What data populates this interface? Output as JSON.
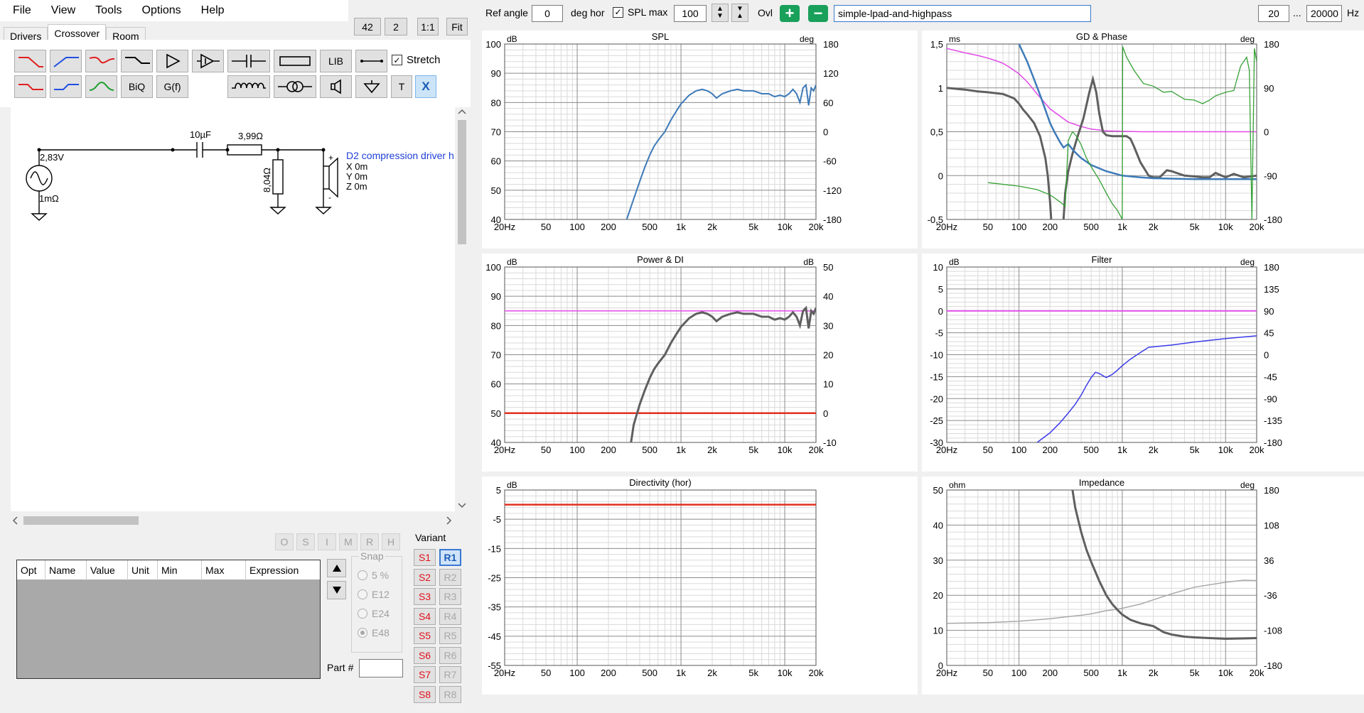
{
  "menu": [
    "File",
    "View",
    "Tools",
    "Options",
    "Help"
  ],
  "tabs": [
    "Drivers",
    "Crossover",
    "Room"
  ],
  "zoom_buttons": [
    "42",
    "2",
    "1:1",
    "Fit"
  ],
  "toolbar": {
    "lib_label": "LIB",
    "biq_label": "BiQ",
    "gf_label": "G(f)",
    "t_label": "T",
    "x_label": "X",
    "stretch_label": "Stretch",
    "stretch_checked": true
  },
  "schematic": {
    "source_voltage": "2,83V",
    "source_impedance": "1mΩ",
    "capacitor": "10µF",
    "series_resistor": "3,99Ω",
    "shunt_resistor": "8,04Ω",
    "driver_name": "D2 compression driver h",
    "driver_x": "X 0m",
    "driver_y": "Y 0m",
    "driver_z": "Z 0m",
    "plus": "+",
    "minus": "-"
  },
  "opt_letters": [
    "O",
    "S",
    "I",
    "M",
    "R",
    "H"
  ],
  "opt_table": {
    "columns": [
      "Opt",
      "Name",
      "Value",
      "Unit",
      "Min",
      "Max",
      "Expression"
    ]
  },
  "snap": {
    "title": "Snap",
    "options": [
      "5 %",
      "E12",
      "E24",
      "E48"
    ],
    "selected": "E48"
  },
  "part_label": "Part #",
  "variant": {
    "label": "Variant",
    "s_buttons": [
      "S1",
      "S2",
      "S3",
      "S4",
      "S5",
      "S6",
      "S7",
      "S8"
    ],
    "r_buttons": [
      "R1",
      "R2",
      "R3",
      "R4",
      "R5",
      "R6",
      "R7",
      "R8"
    ],
    "selected": "R1"
  },
  "topbar": {
    "ref_angle_label": "Ref angle",
    "ref_angle_value": "0",
    "deg_hor_label": "deg hor",
    "spl_max_label": "SPL max",
    "spl_max_checked": true,
    "spl_max_value": "100",
    "ovl_label": "Ovl",
    "name_value": "simple-lpad-and-highpass",
    "freq_min": "20",
    "dots": "...",
    "freq_max": "20000",
    "hz_label": "Hz"
  },
  "colors": {
    "spl_curve": "#3d7ab8",
    "power": "#5f5f5f",
    "di": "#e0301e",
    "magenta": "#e24ae8",
    "phase": "#35a035",
    "filter": "#3b3bea",
    "impedance_phase": "#a9a9a9"
  },
  "freq_ticks": [
    "20Hz",
    "50",
    "100",
    "200",
    "500",
    "1k",
    "2k",
    "5k",
    "10k",
    "20k"
  ],
  "charts": {
    "spl": {
      "title": "SPL",
      "left_unit": "dB",
      "right_unit": "deg",
      "left_ticks": [
        "100",
        "90",
        "80",
        "70",
        "60",
        "50",
        "40"
      ],
      "right_ticks": [
        "180",
        "120",
        "60",
        "0",
        "-60",
        "-120",
        "-180"
      ]
    },
    "gd_phase": {
      "title": "GD & Phase",
      "left_unit": "ms",
      "right_unit": "deg",
      "left_ticks": [
        "1,5",
        "1",
        "0,5",
        "0",
        "-0,5"
      ],
      "right_ticks": [
        "180",
        "90",
        "0",
        "-90",
        "-180"
      ]
    },
    "power_di": {
      "title": "Power & DI",
      "left_unit": "dB",
      "right_unit": "dB",
      "left_ticks": [
        "100",
        "90",
        "80",
        "70",
        "60",
        "50",
        "40"
      ],
      "right_ticks": [
        "50",
        "40",
        "30",
        "20",
        "10",
        "0",
        "-10"
      ]
    },
    "filter": {
      "title": "Filter",
      "left_unit": "dB",
      "right_unit": "deg",
      "left_ticks": [
        "10",
        "5",
        "0",
        "-5",
        "-10",
        "-15",
        "-20",
        "-25",
        "-30"
      ],
      "right_ticks": [
        "180",
        "135",
        "90",
        "45",
        "0",
        "-45",
        "-90",
        "-135",
        "-180"
      ]
    },
    "directivity": {
      "title": "Directivity (hor)",
      "left_unit": "dB",
      "right_unit": "",
      "left_ticks": [
        "5",
        "-5",
        "-15",
        "-25",
        "-35",
        "-45",
        "-55"
      ],
      "right_ticks": []
    },
    "impedance": {
      "title": "Impedance",
      "left_unit": "ohm",
      "right_unit": "deg",
      "left_ticks": [
        "50",
        "40",
        "30",
        "20",
        "10",
        "0"
      ],
      "right_ticks": [
        "180",
        "108",
        "36",
        "-36",
        "-108",
        "-180"
      ]
    }
  },
  "chart_data": [
    {
      "type": "line",
      "title": "SPL",
      "xscale": "log",
      "xlim": [
        20,
        20000
      ],
      "ylim": [
        40,
        100
      ],
      "ylabel": "dB",
      "series": [
        {
          "x": [
            300,
            350,
            400,
            450,
            500,
            550,
            600,
            700,
            800,
            900,
            1000,
            1200,
            1400,
            1600,
            1800,
            2000,
            2200,
            2500,
            3000,
            3500,
            4000,
            5000,
            6000,
            7000,
            8000,
            9000,
            10000,
            11000,
            12000,
            13000,
            14000,
            15000,
            16000,
            17000,
            18000,
            19000,
            20000
          ],
          "y": [
            40,
            47,
            53,
            58,
            62,
            65,
            67,
            70,
            74,
            77,
            79.5,
            82.5,
            84,
            84.5,
            84,
            83,
            81.5,
            83,
            84,
            84.5,
            84,
            84,
            83,
            83,
            82,
            82.5,
            82,
            83,
            84.5,
            83,
            80,
            85,
            86,
            79,
            85,
            84,
            86
          ]
        }
      ]
    },
    {
      "type": "line",
      "title": "Power & DI",
      "xscale": "log",
      "xlim": [
        20,
        20000
      ],
      "ylim": [
        40,
        100
      ],
      "ylabel": "dB",
      "series": [
        {
          "x": [
            330,
            350,
            400,
            450,
            500,
            550,
            600,
            700,
            800,
            900,
            1000,
            1200,
            1400,
            1600,
            1800,
            2000,
            2200,
            2500,
            3000,
            3500,
            4000,
            5000,
            6000,
            7000,
            8000,
            9000,
            10000,
            11000,
            12000,
            13000,
            14000,
            15000,
            16000,
            17000,
            18000,
            19000,
            20000
          ],
          "y": [
            40,
            46,
            53,
            58,
            62,
            65,
            67,
            70,
            74,
            77,
            79.5,
            82.5,
            84,
            84.5,
            84,
            83,
            81.5,
            83,
            84,
            84.5,
            84,
            84,
            83,
            83,
            82,
            82.5,
            82,
            83,
            84.5,
            83,
            80,
            85,
            86,
            79,
            85,
            84,
            86
          ]
        },
        {
          "name": "",
          "x": [
            20,
            20000
          ],
          "y": [
            85,
            85
          ]
        },
        {
          "name": "",
          "x": [
            20,
            20000
          ],
          "y": [
            50,
            50
          ]
        }
      ]
    },
    {
      "type": "line",
      "title": "Directivity (hor)",
      "xscale": "log",
      "xlim": [
        20,
        20000
      ],
      "ylim": [
        -55,
        5
      ],
      "ylabel": "dB",
      "series": [
        {
          "x": [
            20,
            20000
          ],
          "y": [
            0,
            0
          ]
        }
      ]
    },
    {
      "type": "line",
      "title": "Filter",
      "xscale": "log",
      "xlim": [
        20,
        20000
      ],
      "ylim": [
        -30,
        10
      ],
      "ylabel": "dB",
      "series": [
        {
          "x": [
            20,
            20000
          ],
          "y": [
            0,
            0
          ]
        },
        {
          "x": [
            150,
            200,
            250,
            300,
            350,
            400,
            450,
            500,
            550,
            600,
            700,
            800,
            900,
            1000,
            1200,
            1500,
            1800,
            2000,
            3000,
            5000,
            10000,
            20000
          ],
          "y": [
            -30,
            -27.8,
            -25.5,
            -23.3,
            -21.3,
            -19.2,
            -17,
            -15.2,
            -14,
            -14.3,
            -15.2,
            -14.5,
            -13.5,
            -12.5,
            -11,
            -9.5,
            -8.3,
            -8.2,
            -7.8,
            -7.1,
            -6.3,
            -5.7
          ]
        }
      ]
    },
    {
      "type": "line",
      "title": "GD & Phase",
      "xscale": "log",
      "xlim": [
        20,
        20000
      ],
      "ylim": [
        -0.5,
        1.5
      ],
      "ylabel": "ms",
      "series": [
        {
          "x": [
            20,
            30,
            40,
            50,
            60,
            70,
            80,
            100,
            120,
            150,
            200,
            300,
            400,
            500,
            700,
            1000,
            1500,
            2000,
            5000,
            10000,
            20000
          ],
          "y": [
            1.45,
            1.4,
            1.37,
            1.34,
            1.31,
            1.28,
            1.24,
            1.16,
            1.07,
            0.93,
            0.76,
            0.61,
            0.56,
            0.53,
            0.51,
            0.505,
            0.5,
            0.5,
            0.5,
            0.5,
            0.5
          ]
        },
        {
          "x": [
            20,
            30,
            40,
            50,
            70,
            90,
            100,
            110,
            120,
            140,
            160,
            180,
            190,
            200,
            205
          ],
          "y": [
            1.0,
            0.98,
            0.96,
            0.95,
            0.93,
            0.88,
            0.82,
            0.75,
            0.7,
            0.6,
            0.45,
            0.2,
            0,
            -0.3,
            -0.5
          ]
        },
        {
          "x": [
            270,
            280,
            300,
            330,
            370,
            420,
            480,
            520,
            560,
            600,
            650,
            700,
            800,
            900,
            1000,
            1100,
            1200,
            1300,
            1500,
            1800,
            2000,
            2300,
            2700,
            3000,
            4000,
            5000,
            6000,
            7000,
            8000,
            10000,
            12000,
            15000,
            20000
          ],
          "y": [
            -0.5,
            -0.2,
            0.05,
            0.25,
            0.45,
            0.65,
            0.95,
            1.1,
            0.95,
            0.7,
            0.5,
            0.46,
            0.45,
            0.45,
            0.45,
            0.45,
            0.42,
            0.33,
            0.15,
            0.0,
            -0.02,
            -0.02,
            0.06,
            0.05,
            0.0,
            -0.01,
            -0.02,
            -0.02,
            0.03,
            -0.02,
            0.02,
            -0.02,
            0.0
          ]
        },
        {
          "x": [
            100,
            120,
            140,
            160,
            180,
            200,
            220,
            250,
            270,
            300,
            340,
            400,
            500,
            700,
            1000,
            1500,
            2000,
            5000,
            10000,
            20000
          ],
          "y": [
            1.5,
            1.3,
            1.1,
            0.92,
            0.75,
            0.6,
            0.5,
            0.38,
            0.32,
            0.36,
            0.28,
            0.2,
            0.12,
            0.05,
            0.0,
            -0.02,
            -0.03,
            -0.04,
            -0.04,
            -0.04
          ]
        }
      ]
    },
    {
      "type": "line",
      "title": "Impedance",
      "xscale": "log",
      "xlim": [
        20,
        20000
      ],
      "ylim": [
        0,
        50
      ],
      "ylabel": "ohm",
      "series": [
        {
          "x": [
            330,
            350,
            400,
            450,
            500,
            600,
            700,
            800,
            900,
            1000,
            1200,
            1500,
            2000,
            2500,
            3000,
            4000,
            5000,
            7000,
            10000,
            15000,
            20000
          ],
          "y": [
            50,
            45,
            38,
            33,
            29.5,
            24,
            20,
            17.5,
            15.8,
            14.5,
            13,
            12,
            11.2,
            9.5,
            8.8,
            8.2,
            8.0,
            7.8,
            7.6,
            7.7,
            7.8
          ]
        },
        {
          "x": [
            20,
            50,
            100,
            200,
            300,
            400,
            500,
            600,
            700,
            800,
            1000,
            1500,
            2000,
            3000,
            5000,
            10000,
            15000,
            20000
          ],
          "y": [
            12,
            12.2,
            12.6,
            13.3,
            13.9,
            14.3,
            14.7,
            15.2,
            15.6,
            15.8,
            16.3,
            17.5,
            18.7,
            20.4,
            22.3,
            23.7,
            24.3,
            24.2
          ]
        }
      ]
    }
  ]
}
